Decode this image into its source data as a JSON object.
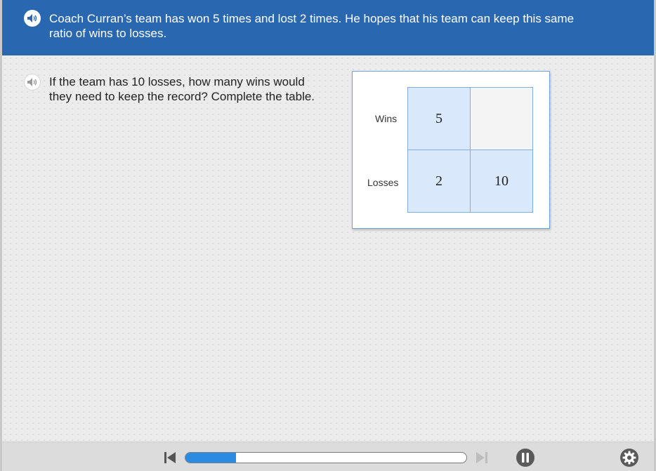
{
  "header": {
    "text": "Coach Curran’s team has won 5 times and lost 2 times. He hopes that his team can keep this same ratio of wins to losses.",
    "audio_icon": "speaker-icon"
  },
  "question": {
    "text": "If the team has 10 losses, how many wins would they need to keep the record? Complete the table.",
    "audio_icon": "speaker-icon"
  },
  "ratio_table": {
    "rows": [
      {
        "label": "Wins",
        "values": [
          "5",
          ""
        ]
      },
      {
        "label": "Losses",
        "values": [
          "2",
          "10"
        ]
      }
    ]
  },
  "footer": {
    "progress": 0.18,
    "controls": [
      "skip-back-icon",
      "skip-forward-icon",
      "pause-icon",
      "gear-icon"
    ]
  },
  "colors": {
    "header_bg": "#2a67b1",
    "cell_bg": "#d9e9fb",
    "progress_fill": "#2b8ae2"
  }
}
